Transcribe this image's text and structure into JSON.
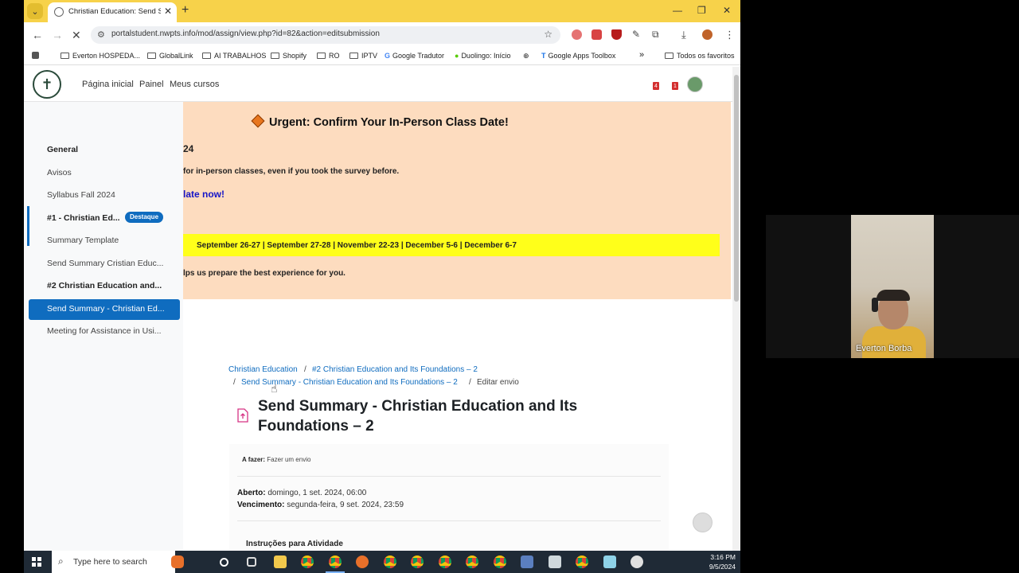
{
  "browser": {
    "tab_title": "Christian Education: Send Sum",
    "url": "portalstudent.nwpts.info/mod/assign/view.php?id=82&action=editsubmission",
    "bookmarks": [
      "Everton HOSPEDA...",
      "GlobalLink",
      "AI TRABALHOS",
      "Shopify",
      "RO",
      "IPTV",
      "Google Tradutor",
      "Duolingo: Início",
      "Google Apps Toolbox"
    ],
    "all_bookmarks": "Todos os favoritos",
    "overflow": "»"
  },
  "site": {
    "nav": [
      "Página inicial",
      "Painel",
      "Meus cursos"
    ],
    "notif_count": "4",
    "msg_count": "1"
  },
  "course_index": {
    "items": [
      {
        "label": "General",
        "bold": true
      },
      {
        "label": "Avisos"
      },
      {
        "label": "Syllabus Fall 2024"
      },
      {
        "label": "#1 - Christian Ed...",
        "bold": true,
        "badge": "Destaque"
      },
      {
        "label": "Summary Template"
      },
      {
        "label": "Send Summary Cristian Educ..."
      },
      {
        "label": "#2 Christian Education and...",
        "bold": true
      },
      {
        "label": "Send Summary - Christian Ed...",
        "active": true
      },
      {
        "label": "Meeting for Assistance in Usi..."
      }
    ]
  },
  "banner": {
    "title": "Urgent: Confirm Your In-Person Class Date!",
    "year_fragment": "24",
    "line1": "for in-person classes, even if you took the survey before.",
    "link": "late now!",
    "dates": "September 26-27  |  September 27-28  |  November 22-23  |  December 5-6  |  December 6-7",
    "line2": "lps us prepare the best experience for you."
  },
  "breadcrumb": {
    "c1": "Christian Education",
    "sep1": "/",
    "c2": "#2 Christian Education and Its Foundations – 2",
    "sep2": "/",
    "c3": "Send Summary - Christian Education and Its Foundations – 2",
    "sep3": "/",
    "c4": "Editar envio"
  },
  "page": {
    "title": "Send Summary - Christian Education and Its Foundations – 2",
    "todo_label": "A fazer:",
    "todo_value": "Fazer um envio",
    "opened_label": "Aberto:",
    "opened_value": "domingo, 1 set. 2024, 06:00",
    "due_label": "Vencimento:",
    "due_value": "segunda-feira, 9 set. 2024, 23:59",
    "instructions": "Instruções para Atividade"
  },
  "video": {
    "participant": "Everton Borba"
  },
  "taskbar": {
    "search_placeholder": "Type here to search",
    "time": "3:16 PM",
    "date": "9/5/2024"
  },
  "colors": {
    "accent": "#0f6cbf",
    "banner_bg": "#fddcbf",
    "dates_bg": "#ffff1a",
    "tabstrip": "#f7d24a"
  }
}
